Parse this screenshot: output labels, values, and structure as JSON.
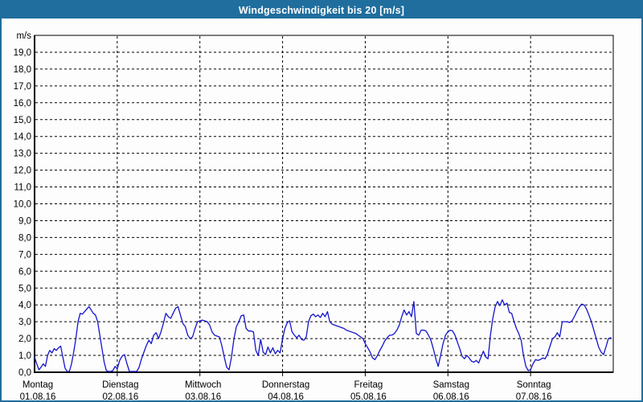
{
  "colors": {
    "accent_blue": "#1f6e9e",
    "line_blue": "#1414cc",
    "grid_black": "#000000",
    "plot_bg": "#fdfdfd",
    "title_text": "#ffffff"
  },
  "chart_data": {
    "type": "line",
    "title": "Windgeschwindigkeit bis 20 [m/s]",
    "y_axis": {
      "unit_label": "m/s",
      "ylim": [
        0,
        20
      ],
      "tick_step": 1,
      "tick_labels_top_to_bottom": [
        "19,0",
        "18,0",
        "17,0",
        "16,0",
        "15,0",
        "14,0",
        "13,0",
        "12,0",
        "11,0",
        "10,0",
        "9,0",
        "8,0",
        "7,0",
        "6,0",
        "5,0",
        "4,0",
        "3,0",
        "2,0",
        "1,0",
        "0,0"
      ]
    },
    "grid": "dashed",
    "legend": "none",
    "series_name": "Windgeschwindigkeit",
    "days": [
      {
        "label": "Montag",
        "date": "01.08.16",
        "values": [
          0.9,
          0.5,
          0.15,
          0.3,
          0.5,
          0.35,
          1.0,
          1.3,
          1.15,
          1.4,
          1.3,
          1.45,
          1.55,
          0.9,
          0.25,
          0.05,
          0.05,
          0.5,
          1.2,
          2.0,
          3.0,
          3.5,
          3.45,
          3.6,
          3.75,
          3.9,
          3.7,
          3.5,
          3.4,
          3.0,
          2.2,
          1.4,
          0.6,
          0.1,
          0.05,
          0.05,
          0.1,
          0.35
        ]
      },
      {
        "label": "Dienstag",
        "date": "02.08.16",
        "values": [
          0.2,
          0.7,
          0.95,
          1.05,
          0.5,
          0.05,
          0.05,
          0.05,
          0.05,
          0.3,
          0.8,
          1.2,
          1.6,
          1.9,
          1.7,
          2.2,
          2.35,
          2.0,
          2.4,
          2.9,
          3.5,
          3.3,
          3.2,
          3.5,
          3.8,
          3.9,
          3.4,
          2.9,
          2.7,
          2.2,
          2.0,
          2.1,
          2.6,
          3.0
        ]
      },
      {
        "label": "Mittwoch",
        "date": "03.08.16",
        "values": [
          3.05,
          3.1,
          3.05,
          3.0,
          2.8,
          2.4,
          2.2,
          2.15,
          2.1,
          1.6,
          0.9,
          0.3,
          0.15,
          0.9,
          2.0,
          2.7,
          3.0,
          3.35,
          3.4,
          2.6,
          2.45,
          2.45,
          2.4,
          1.3,
          1.0,
          1.95,
          1.2,
          1.05,
          1.5,
          1.15,
          1.45,
          1.1,
          1.3,
          1.15
        ]
      },
      {
        "label": "Donnerstag",
        "date": "04.08.16",
        "values": [
          2.0,
          2.6,
          2.95,
          3.05,
          2.4,
          2.2,
          2.05,
          2.2,
          1.95,
          1.9,
          2.1,
          3.0,
          3.35,
          3.45,
          3.3,
          3.4,
          3.25,
          3.5,
          3.3,
          3.6,
          3.0,
          2.85,
          2.8,
          2.75,
          2.7,
          2.65,
          2.6,
          2.5,
          2.45,
          2.4,
          2.35,
          2.3,
          2.2,
          2.1,
          2.0
        ]
      },
      {
        "label": "Freitag",
        "date": "05.08.16",
        "values": [
          1.7,
          1.45,
          1.2,
          0.85,
          0.75,
          1.0,
          1.3,
          1.55,
          1.85,
          2.05,
          2.2,
          2.2,
          2.3,
          2.5,
          2.8,
          3.3,
          3.7,
          3.4,
          3.6,
          3.3,
          4.2,
          2.3,
          2.2,
          2.5,
          2.5,
          2.45,
          2.2,
          1.9,
          1.4,
          0.8,
          0.35,
          1.0,
          1.7,
          2.2
        ]
      },
      {
        "label": "Samstag",
        "date": "06.08.16",
        "values": [
          2.4,
          2.5,
          2.45,
          2.2,
          1.8,
          1.4,
          0.95,
          0.8,
          1.0,
          0.85,
          0.65,
          0.6,
          0.7,
          0.55,
          0.9,
          1.25,
          0.9,
          0.8,
          2.2,
          3.2,
          3.9,
          4.2,
          3.95,
          4.3,
          4.0,
          4.1,
          3.55,
          3.5,
          3.0,
          2.6,
          2.3,
          1.9,
          1.0,
          0.35,
          0.1
        ]
      },
      {
        "label": "Sonntag",
        "date": "07.08.16",
        "values": [
          0.15,
          0.5,
          0.75,
          0.7,
          0.75,
          0.85,
          0.8,
          1.1,
          1.55,
          2.0,
          2.1,
          2.35,
          2.1,
          3.0,
          3.0,
          3.0,
          2.95,
          3.05,
          3.3,
          3.6,
          3.85,
          4.05,
          4.0,
          3.75,
          3.4,
          3.0,
          2.5,
          2.0,
          1.5,
          1.2,
          1.05,
          1.5,
          2.0,
          2.05
        ]
      }
    ]
  }
}
